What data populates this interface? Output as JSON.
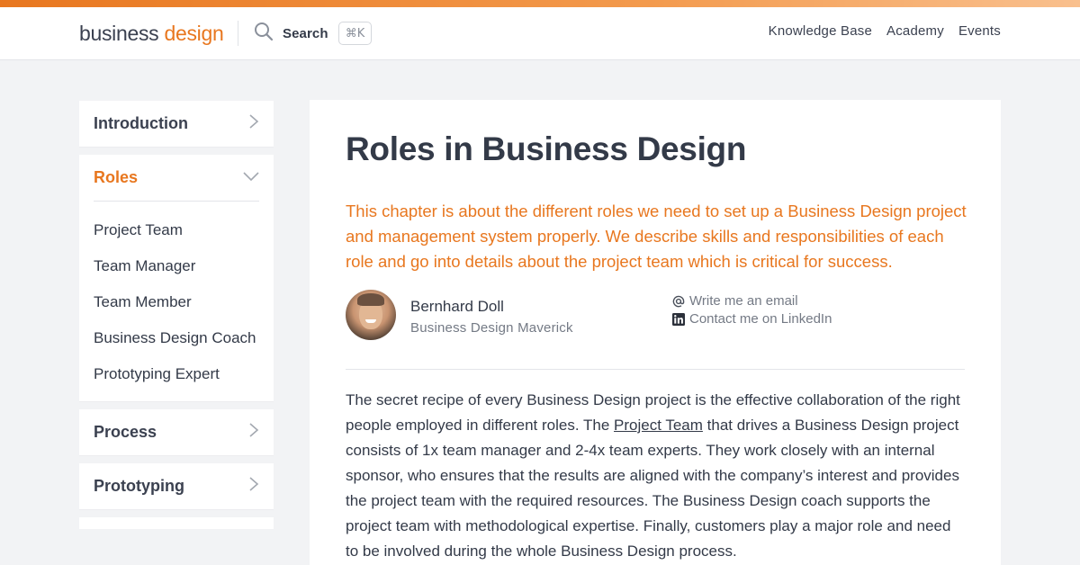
{
  "header": {
    "logo": {
      "part1": "business",
      "part2": "design"
    },
    "search_label": "Search",
    "search_shortcut": "⌘K",
    "nav": [
      "Knowledge Base",
      "Academy",
      "Events"
    ]
  },
  "sidebar": {
    "sections": [
      {
        "title": "Introduction",
        "expanded": false
      },
      {
        "title": "Roles",
        "expanded": true,
        "items": [
          "Project Team",
          "Team Manager",
          "Team Member",
          "Business Design Coach",
          "Prototyping Expert"
        ]
      },
      {
        "title": "Process",
        "expanded": false
      },
      {
        "title": "Prototyping",
        "expanded": false
      }
    ]
  },
  "main": {
    "title": "Roles in Business Design",
    "lead": "This chapter is about the different roles we need to set up a Business Design project and management system properly. We describe skills and responsibilities of each role and go into details about the project team which is critical for success.",
    "author": {
      "name": "Bernhard Doll",
      "role": "Business Design Maverick",
      "email_label": "Write me an email",
      "linkedin_label": "Contact me on LinkedIn"
    },
    "body": {
      "before_link": "The secret recipe of every Business Design project is the effective collaboration of the right people employed in different roles. The ",
      "link": "Project Team",
      "after_link": " that drives a Business Design project consists of 1x team manager and 2-4x team experts. They work closely with an internal sponsor, who ensures that the results are aligned with the company’s interest and provides the project team with the required resources. The Business Design coach supports the project team with methodological expertise. Finally, customers play a major role and need to be involved during the whole Business Design process."
    }
  },
  "colors": {
    "accent": "#e8771f",
    "text": "#333a48",
    "muted": "#747a85",
    "background": "#f2f3f5"
  }
}
